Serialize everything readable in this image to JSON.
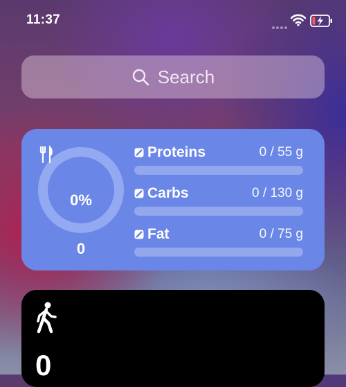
{
  "status_bar": {
    "time": "11:37"
  },
  "search": {
    "placeholder": "Search"
  },
  "nutrition": {
    "percent_label": "0%",
    "progress_fraction": 0,
    "calories": "0",
    "macros": [
      {
        "label": "Proteins",
        "value": "0 / 55 g",
        "progress": 0
      },
      {
        "label": "Carbs",
        "value": "0 / 130 g",
        "progress": 0
      },
      {
        "label": "Fat",
        "value": "0 / 75 g",
        "progress": 0
      }
    ]
  },
  "steps": {
    "count": "0"
  },
  "icons": {
    "search": "search-icon",
    "wifi": "wifi-icon",
    "battery": "battery-charging-icon",
    "meal": "fork-knife-icon",
    "macro": "nutrient-badge-icon",
    "steps": "walking-person-icon"
  },
  "colors": {
    "nutrition_card": "#6a86e6",
    "ring_track": "#93a9f2",
    "battery_accent": "#ff5a5a",
    "steps_card": "#000000"
  }
}
